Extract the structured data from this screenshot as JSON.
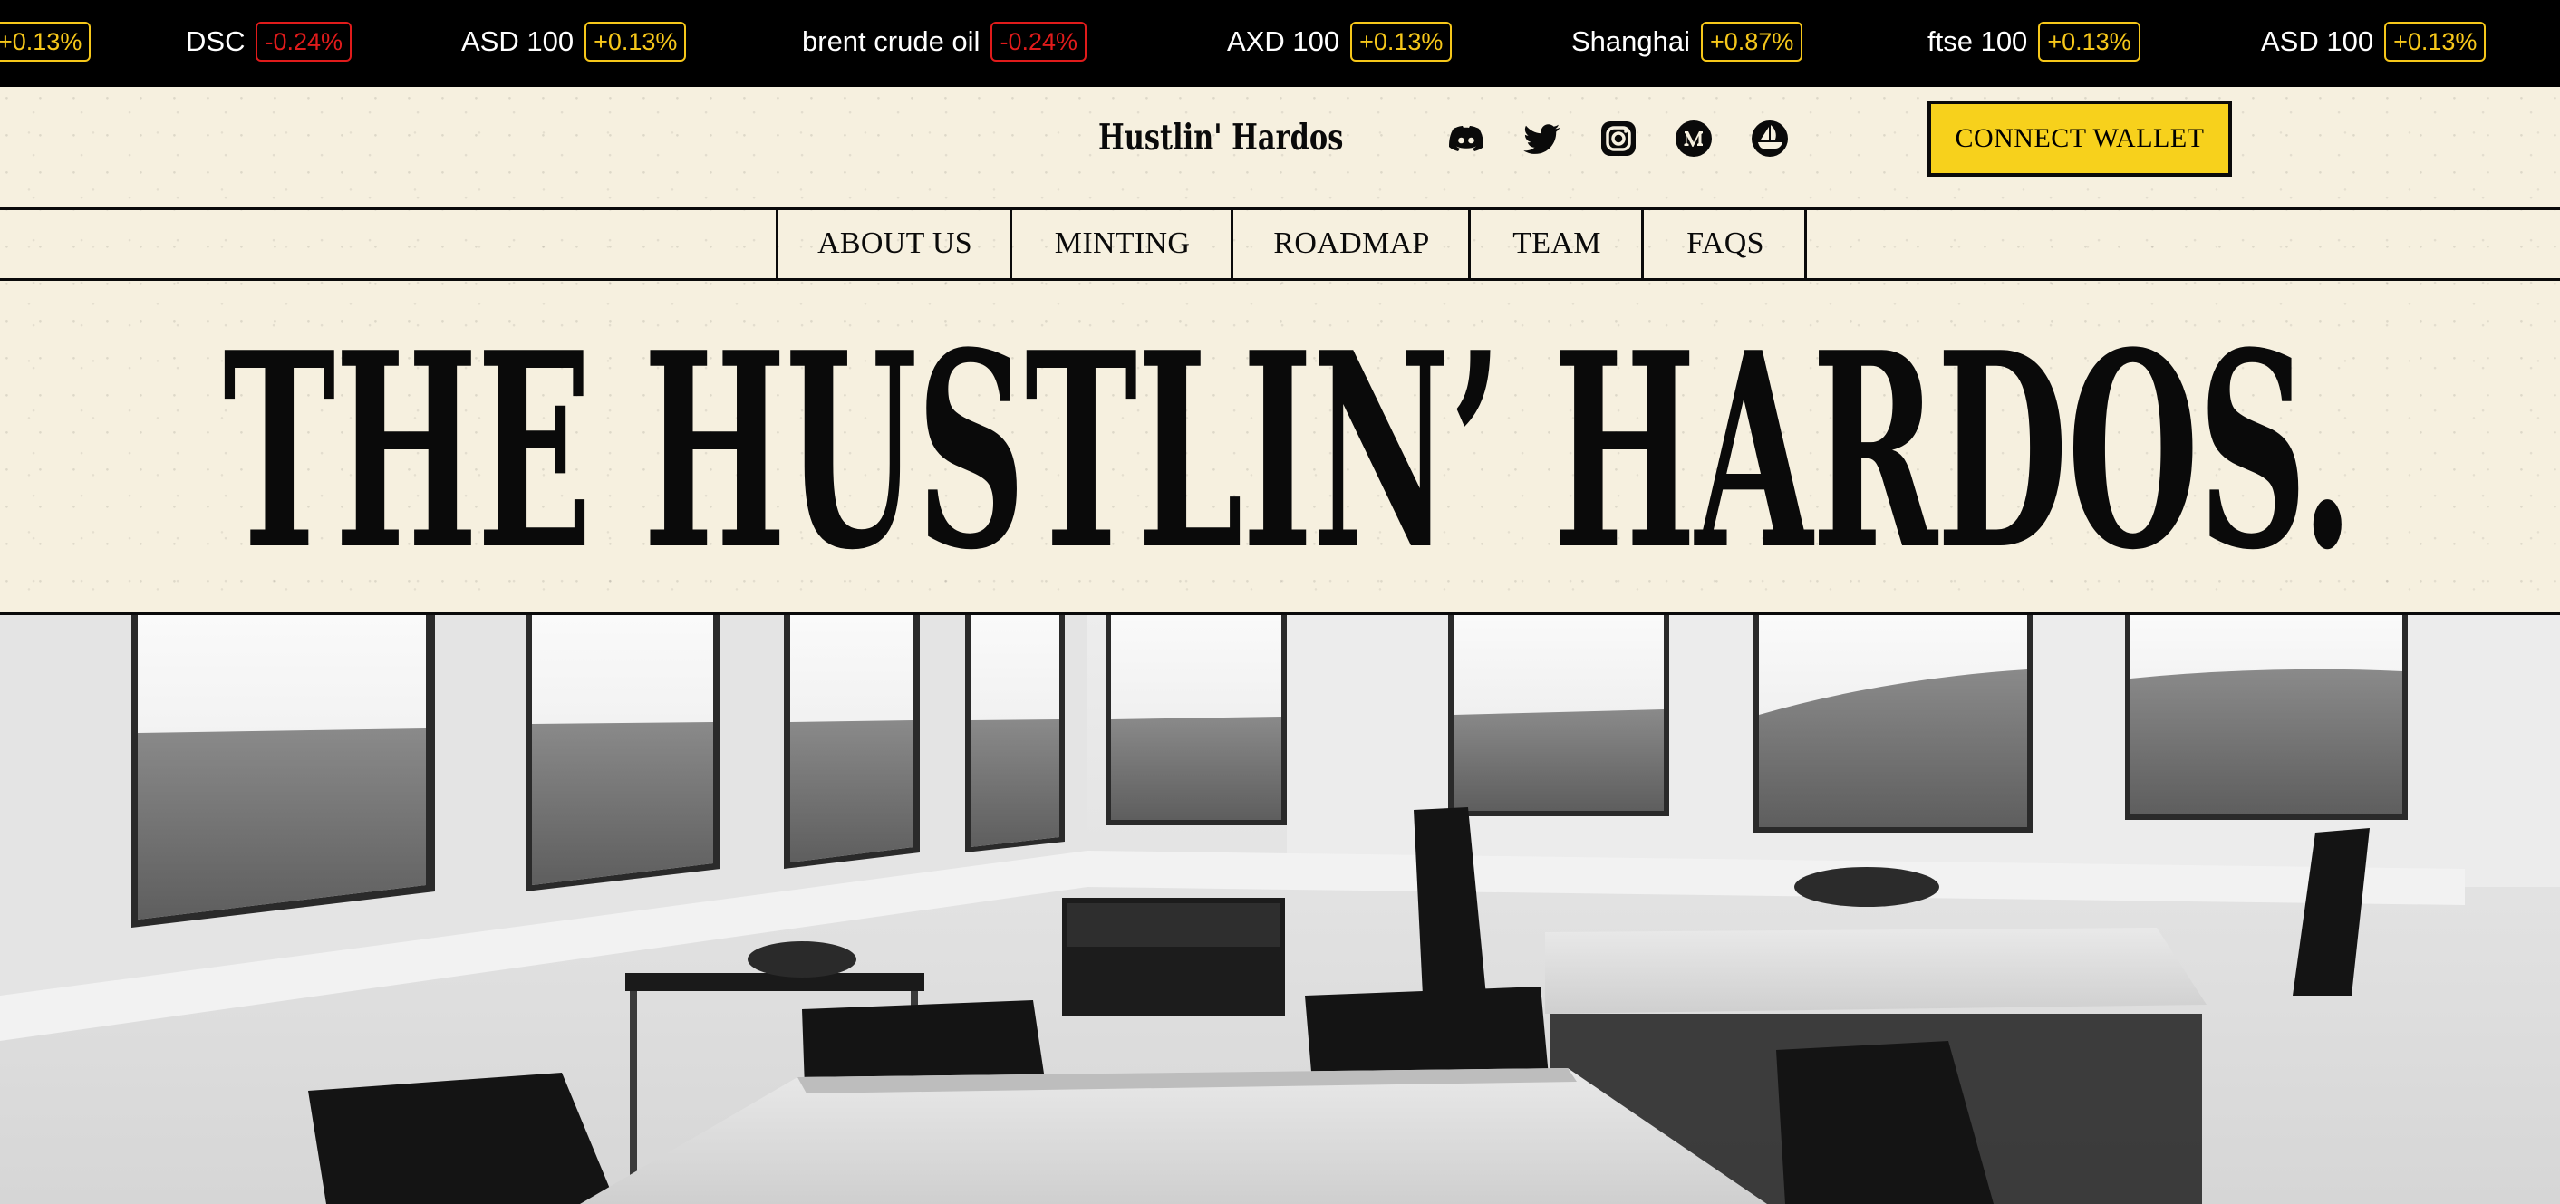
{
  "ticker": {
    "items": [
      {
        "name": "",
        "change": "+0.13%",
        "direction": "up"
      },
      {
        "name": "DSC",
        "change": "-0.24%",
        "direction": "down"
      },
      {
        "name": "ASD 100",
        "change": "+0.13%",
        "direction": "up"
      },
      {
        "name": "brent crude oil",
        "change": "-0.24%",
        "direction": "down"
      },
      {
        "name": "AXD 100",
        "change": "+0.13%",
        "direction": "up"
      },
      {
        "name": "Shanghai",
        "change": "+0.87%",
        "direction": "up"
      },
      {
        "name": "ftse 100",
        "change": "+0.13%",
        "direction": "up"
      },
      {
        "name": "ASD 100",
        "change": "+0.13%",
        "direction": "up"
      }
    ]
  },
  "header": {
    "brand": "Hustlin' Hardos",
    "social_icons": [
      "discord-icon",
      "twitter-icon",
      "instagram-icon",
      "medium-icon",
      "opensea-icon"
    ],
    "connect_wallet_label": "CONNECT WALLET"
  },
  "nav": {
    "items": [
      {
        "label": "ABOUT US"
      },
      {
        "label": "MINTING"
      },
      {
        "label": "ROADMAP"
      },
      {
        "label": "TEAM"
      },
      {
        "label": "FAQS"
      }
    ]
  },
  "hero": {
    "title": "THE HUSTLIN’ HARDOS."
  },
  "colors": {
    "paper": "#f6f0df",
    "ink": "#0a0a0a",
    "accent_yellow": "#f7d11c",
    "ticker_up": "#f6c71a",
    "ticker_down": "#e01b1b"
  }
}
